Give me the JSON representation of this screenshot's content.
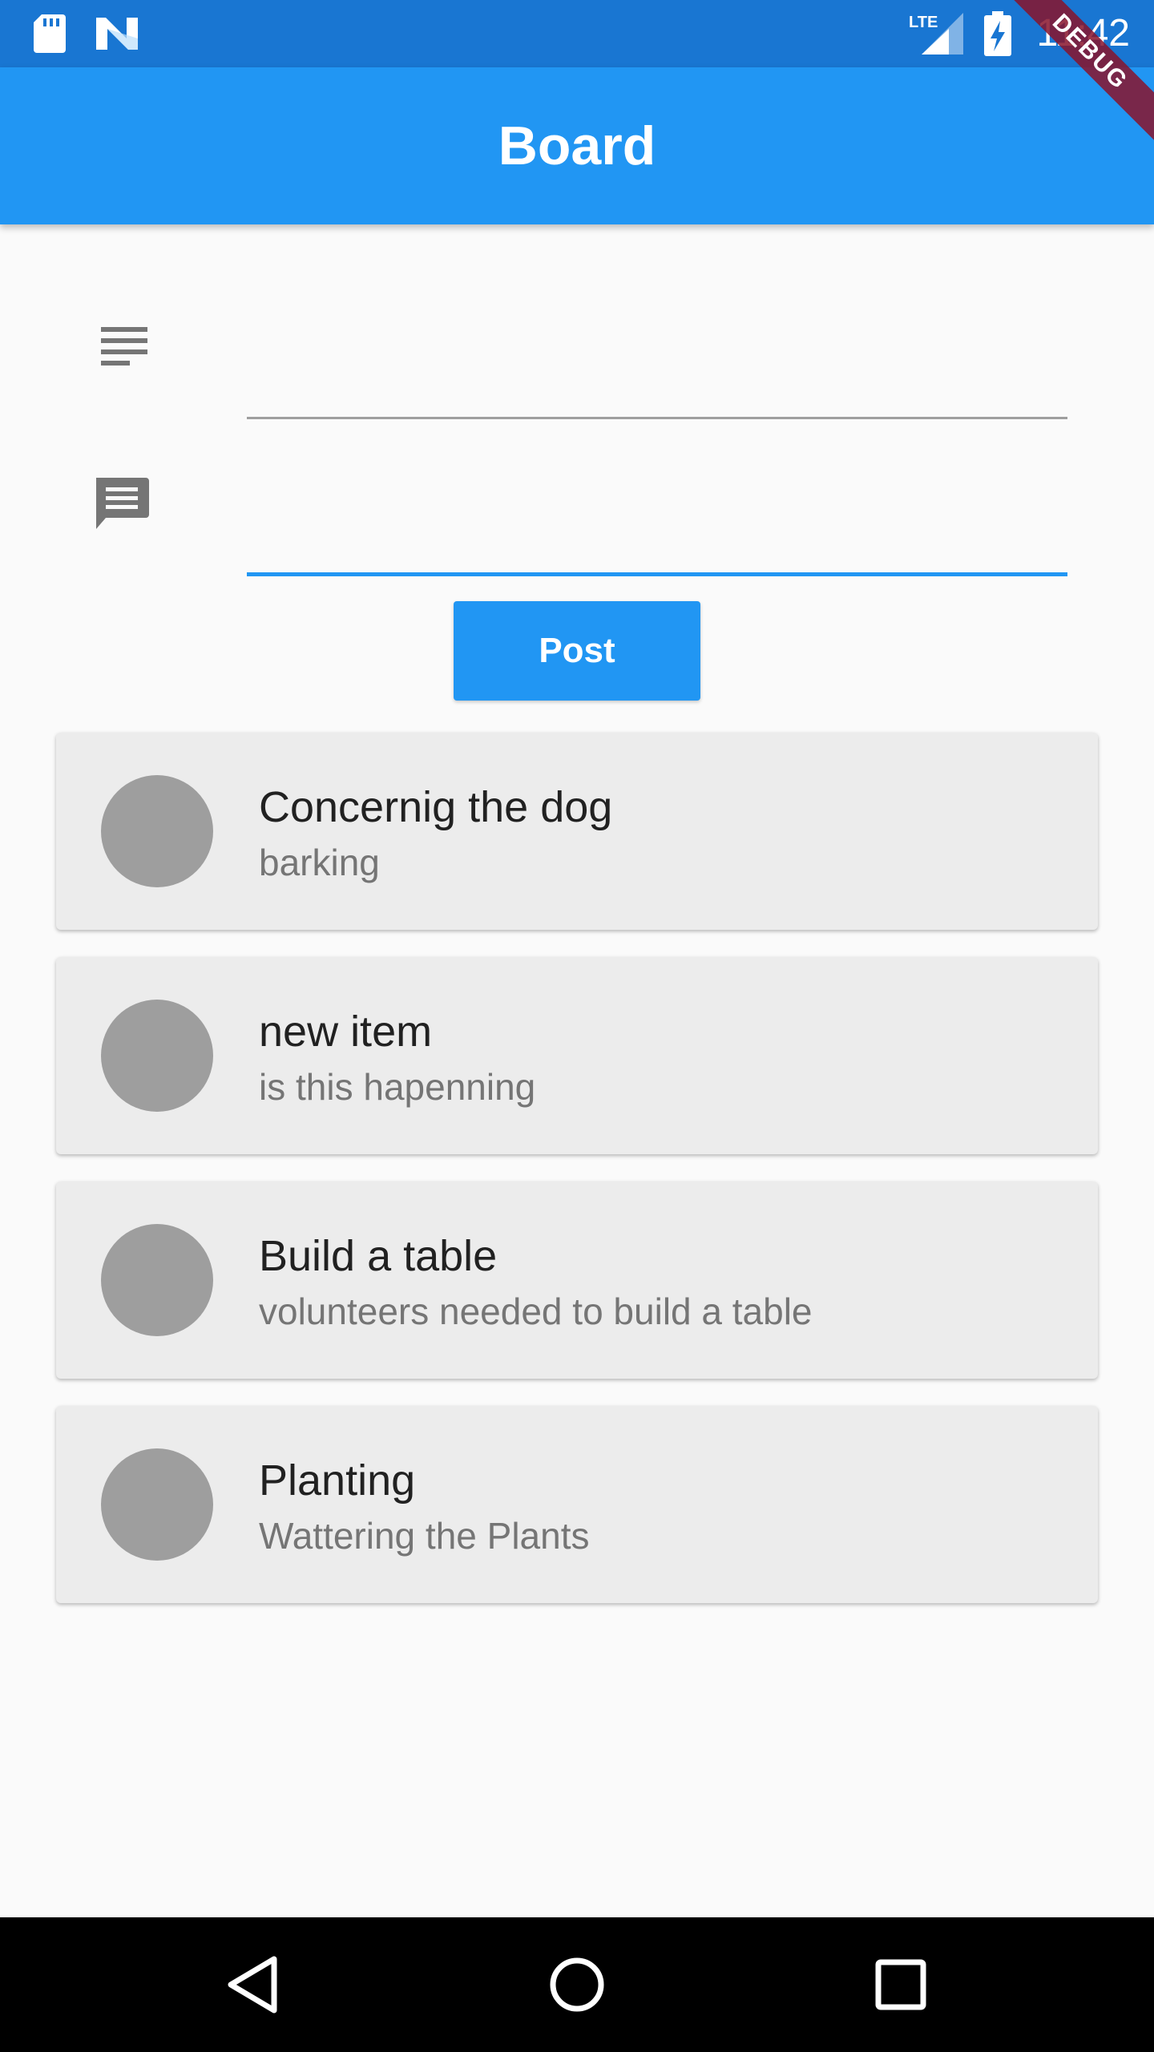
{
  "status_bar": {
    "time": "11:42",
    "network": "LTE",
    "icons": [
      "sd-card-icon",
      "n-logo-icon",
      "lte-signal-icon",
      "battery-charging-icon"
    ]
  },
  "debug_banner": "DEBUG",
  "app_bar": {
    "title": "Board"
  },
  "form": {
    "subject": {
      "icon": "subject-icon",
      "value": "",
      "placeholder": ""
    },
    "message": {
      "icon": "message-icon",
      "value": "",
      "placeholder": ""
    },
    "post_label": "Post"
  },
  "posts": [
    {
      "title": "Concernig the dog",
      "body": "barking"
    },
    {
      "title": "new item",
      "body": "is this hapenning"
    },
    {
      "title": "Build a table",
      "body": "volunteers needed to build a table"
    },
    {
      "title": "Planting",
      "body": "Wattering the Plants"
    }
  ],
  "nav_bar": {
    "icons": [
      "back-icon",
      "home-icon",
      "recents-icon"
    ]
  },
  "colors": {
    "primary": "#2196f3",
    "status_bar": "#1976d2",
    "card": "#ececec",
    "avatar": "#9e9e9e",
    "background": "#fafafa"
  }
}
